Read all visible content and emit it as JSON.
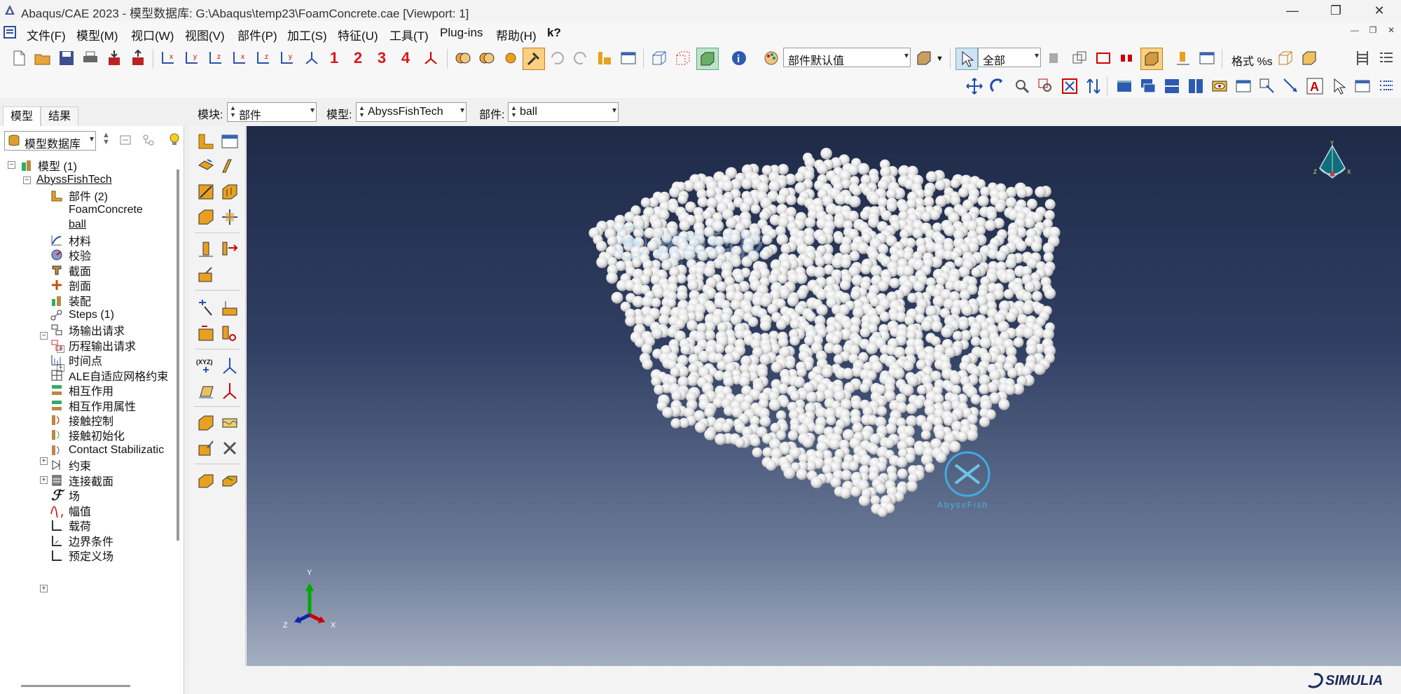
{
  "window": {
    "title": "Abaqus/CAE 2023 - 模型数据库: G:\\Abaqus\\temp23\\FoamConcrete.cae [Viewport: 1]",
    "minimize": "—",
    "restore": "❐",
    "close": "✕"
  },
  "menu": [
    "文件(F)",
    "模型(M)",
    "视口(W)",
    "视图(V)",
    "部件(P)",
    "加工(S)",
    "特征(U)",
    "工具(T)",
    "Plug-ins",
    "帮助(H)",
    "k?"
  ],
  "toolbar": {
    "view_numbers": [
      "1",
      "2",
      "3",
      "4"
    ],
    "render_style": "部件默认值",
    "selection_filter": "全部",
    "format_label": "格式 %s"
  },
  "left_tabs": [
    "模型",
    "结果"
  ],
  "tree_selector": "模型数据库",
  "tree": [
    {
      "label": "模型 (1)",
      "icon": "models-icon"
    },
    {
      "label": "AbyssFishTech",
      "icon": ""
    },
    {
      "label": "部件 (2)",
      "icon": "parts-icon"
    },
    {
      "label": "FoamConcrete",
      "icon": ""
    },
    {
      "label": "ball",
      "icon": ""
    },
    {
      "label": "材料",
      "icon": "materials-icon"
    },
    {
      "label": "校验",
      "icon": "calibration-icon"
    },
    {
      "label": "截面",
      "icon": "sections-icon"
    },
    {
      "label": "剖面",
      "icon": "profiles-icon"
    },
    {
      "label": "装配",
      "icon": "assembly-icon"
    },
    {
      "label": "Steps (1)",
      "icon": "steps-icon"
    },
    {
      "label": "场输出请求",
      "icon": "field-output-icon"
    },
    {
      "label": "历程输出请求",
      "icon": "history-output-icon"
    },
    {
      "label": "时间点",
      "icon": "time-points-icon"
    },
    {
      "label": "ALE自适应网格约束",
      "icon": "ale-icon"
    },
    {
      "label": "相互作用",
      "icon": "interactions-icon"
    },
    {
      "label": "相互作用属性",
      "icon": "interaction-props-icon"
    },
    {
      "label": "接触控制",
      "icon": "contact-controls-icon"
    },
    {
      "label": "接触初始化",
      "icon": "contact-init-icon"
    },
    {
      "label": "Contact Stabilizatic",
      "icon": "contact-stab-icon"
    },
    {
      "label": "约束",
      "icon": "constraints-icon"
    },
    {
      "label": "连接截面",
      "icon": "connector-sections-icon"
    },
    {
      "label": "场",
      "icon": "fields-icon"
    },
    {
      "label": "幅值",
      "icon": "amplitudes-icon"
    },
    {
      "label": "载荷",
      "icon": "loads-icon"
    },
    {
      "label": "边界条件",
      "icon": "bcs-icon"
    },
    {
      "label": "预定义场",
      "icon": "predefined-fields-icon"
    }
  ],
  "context": {
    "module_label": "模块:",
    "module_value": "部件",
    "model_label": "模型:",
    "model_value": "AbyssFishTech",
    "part_label": "部件:",
    "part_value": "ball"
  },
  "viewport": {
    "watermark_cn": "渊鱼科技",
    "watermark_en": "AbyssFishTech",
    "watermark2": "AbyssFish",
    "triad": {
      "x": "X",
      "y": "Y",
      "z": "Z"
    },
    "brand": "SIMULIA"
  }
}
